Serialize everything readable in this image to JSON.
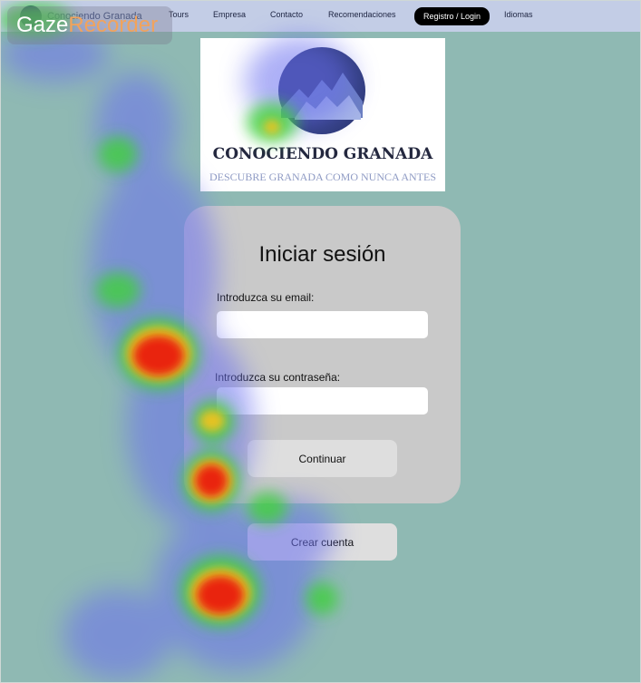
{
  "nav": {
    "brand": "Conociendo Granada",
    "links": [
      "Tours",
      "Empresa",
      "Contacto",
      "Recomendaciones"
    ],
    "login": "Registro / Login",
    "language": "Idiomas"
  },
  "watermark": {
    "part1": "Gaze",
    "part2": "Recorder"
  },
  "hero": {
    "title": "CONOCIENDO GRANADA",
    "subtitle": "DESCUBRE GRANADA COMO NUNCA ANTES"
  },
  "login": {
    "title": "Iniciar sesión",
    "email_label": "Introduzca su email:",
    "password_label": "Introduzca su contraseña:",
    "continue_label": "Continuar"
  },
  "create_account_label": "Crear cuenta",
  "colors": {
    "background": "#8fb9b3",
    "navbar": "#c3cde6",
    "card": "#c9c9c9",
    "button": "#dedede",
    "login_pill": "#000000"
  }
}
